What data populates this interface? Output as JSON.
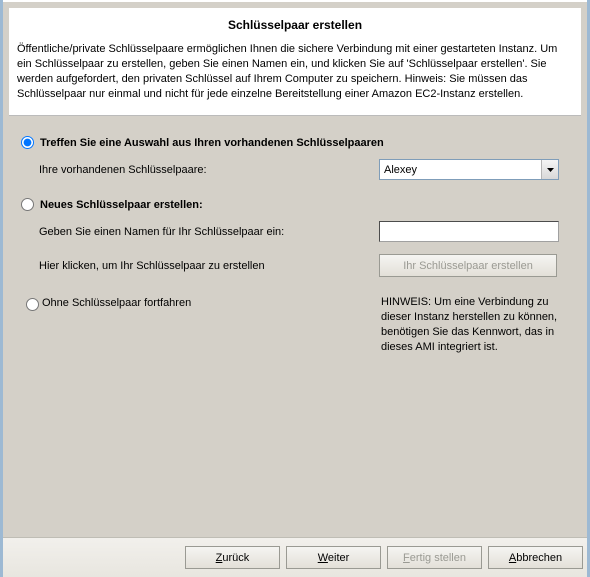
{
  "title": "Schlüsselpaar erstellen",
  "intro": "Öffentliche/private Schlüsselpaare ermöglichen Ihnen die sichere Verbindung mit einer gestarteten Instanz. Um ein Schlüsselpaar zu erstellen, geben Sie einen Namen ein, und klicken Sie auf 'Schlüsselpaar erstellen'. Sie werden aufgefordert, den privaten Schlüssel auf Ihrem Computer zu speichern. Hinweis: Sie müssen das Schlüsselpaar nur einmal und nicht für jede einzelne Bereitstellung einer Amazon EC2-Instanz erstellen.",
  "option1": {
    "label": "Treffen Sie eine Auswahl aus Ihren vorhandenen Schlüsselpaaren",
    "sub_label": "Ihre vorhandenen Schlüsselpaare:",
    "selected_value": "Alexey",
    "checked": true
  },
  "option2": {
    "label": "Neues Schlüsselpaar erstellen:",
    "name_label": "Geben Sie einen Namen für Ihr Schlüsselpaar ein:",
    "name_value": "",
    "create_label": "Hier klicken, um Ihr Schlüsselpaar zu erstellen",
    "create_button": "Ihr Schlüsselpaar erstellen",
    "checked": false
  },
  "option3": {
    "label": "Ohne Schlüsselpaar fortfahren",
    "hint": "HINWEIS: Um eine Verbindung zu dieser Instanz herstellen zu können, benötigen Sie das Kennwort, das in dieses AMI integriert ist.",
    "checked": false
  },
  "footer": {
    "back": "Zurück",
    "next": "Weiter",
    "finish": "Fertig stellen",
    "cancel": "Abbrechen"
  }
}
